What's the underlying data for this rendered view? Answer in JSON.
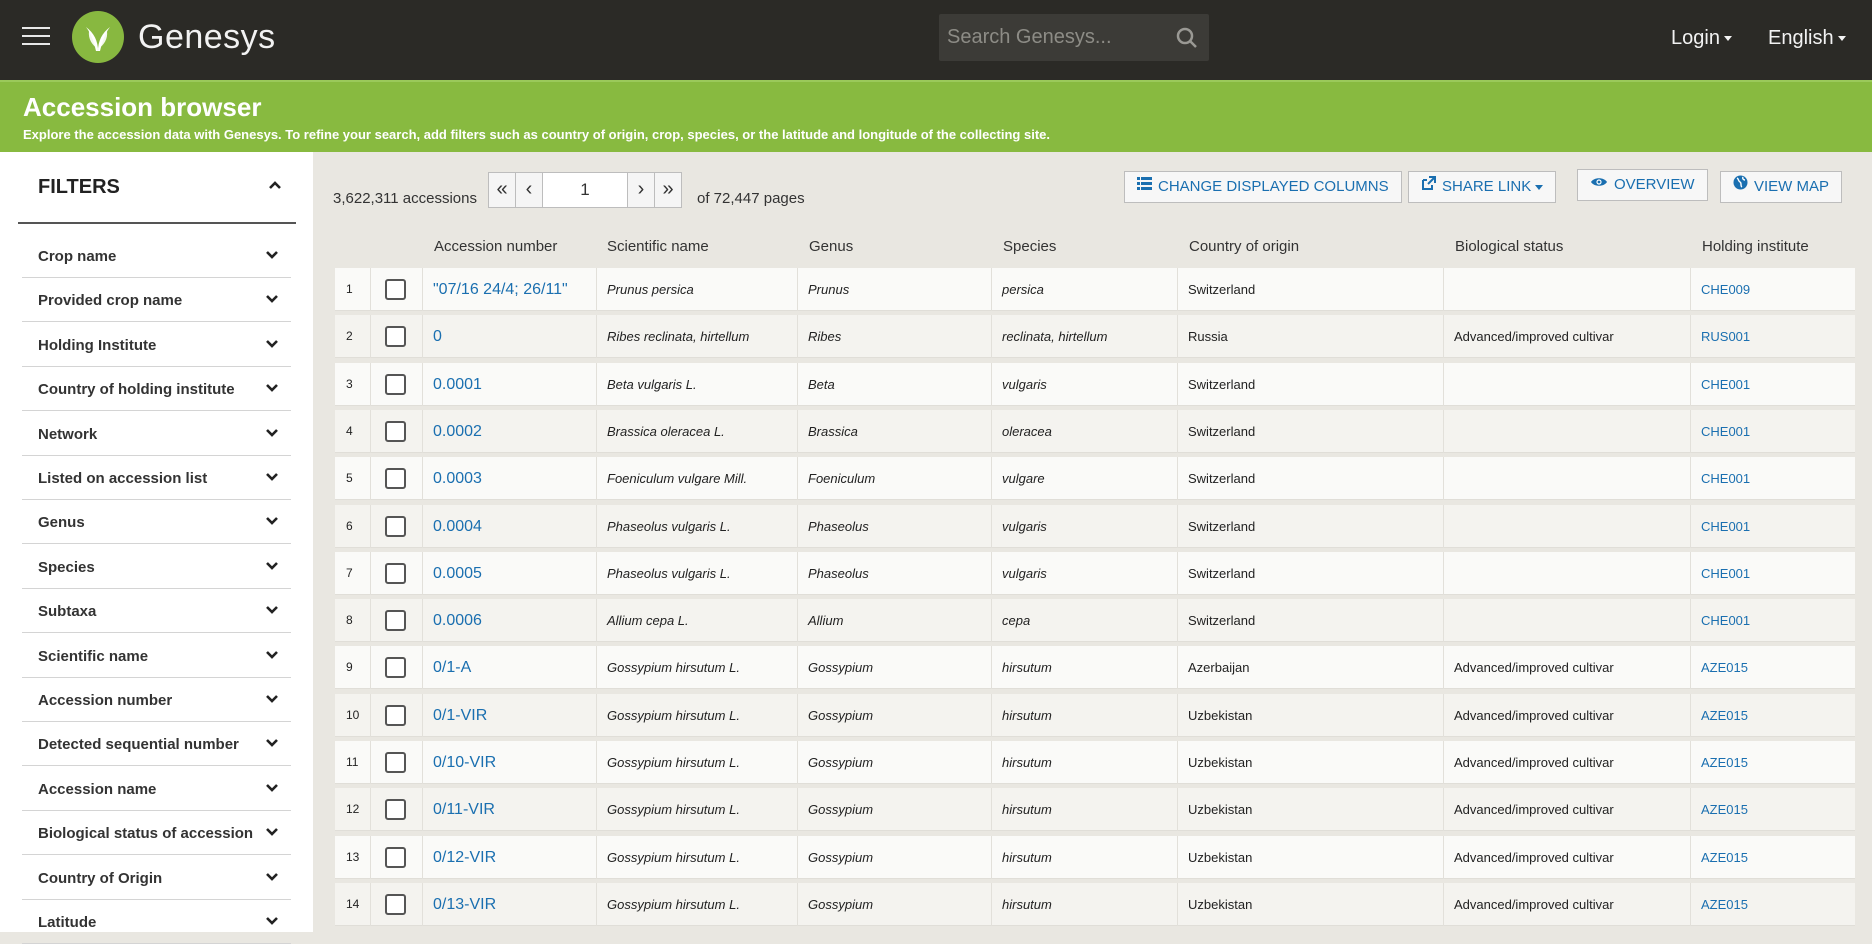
{
  "header": {
    "brand": "Genesys",
    "search_placeholder": "Search Genesys...",
    "login_label": "Login",
    "language_label": "English"
  },
  "banner": {
    "title": "Accession browser",
    "subtitle": "Explore the accession data with Genesys. To refine your search, add filters such as country of origin, crop, species, or the latitude and longitude of the collecting site."
  },
  "sidebar": {
    "title": "FILTERS",
    "items": [
      {
        "label": "Crop name"
      },
      {
        "label": "Provided crop name"
      },
      {
        "label": "Holding Institute"
      },
      {
        "label": "Country of holding institute"
      },
      {
        "label": "Network"
      },
      {
        "label": "Listed on accession list"
      },
      {
        "label": "Genus"
      },
      {
        "label": "Species"
      },
      {
        "label": "Subtaxa"
      },
      {
        "label": "Scientific name"
      },
      {
        "label": "Accession number"
      },
      {
        "label": "Detected sequential number"
      },
      {
        "label": "Accession name"
      },
      {
        "label": "Biological status of accession"
      },
      {
        "label": "Country of Origin"
      },
      {
        "label": "Latitude"
      }
    ]
  },
  "toolbar": {
    "count_label": "3,622,311 accessions",
    "first": "«",
    "prev": "‹",
    "next": "›",
    "last": "»",
    "page_value": "1",
    "pages_label": "of 72,447 pages",
    "change_columns": "CHANGE DISPLAYED COLUMNS",
    "share_link": "SHARE LINK",
    "overview": "OVERVIEW",
    "view_map": "VIEW MAP"
  },
  "table": {
    "columns": [
      "Accession number",
      "Scientific name",
      "Genus",
      "Species",
      "Country of origin",
      "Biological status",
      "Holding institute"
    ],
    "rows": [
      {
        "n": "1",
        "acc": "\"07/16 24/4; 26/11\"",
        "sci": "Prunus persica",
        "genus": "Prunus",
        "species": "persica",
        "country": "Switzerland",
        "status": "",
        "inst": "CHE009"
      },
      {
        "n": "2",
        "acc": "0",
        "sci": "Ribes reclinata, hirtellum",
        "genus": "Ribes",
        "species": "reclinata, hirtellum",
        "country": "Russia",
        "status": "Advanced/improved cultivar",
        "inst": "RUS001"
      },
      {
        "n": "3",
        "acc": "0.0001",
        "sci": "Beta vulgaris L.",
        "genus": "Beta",
        "species": "vulgaris",
        "country": "Switzerland",
        "status": "",
        "inst": "CHE001"
      },
      {
        "n": "4",
        "acc": "0.0002",
        "sci": "Brassica oleracea L.",
        "genus": "Brassica",
        "species": "oleracea",
        "country": "Switzerland",
        "status": "",
        "inst": "CHE001"
      },
      {
        "n": "5",
        "acc": "0.0003",
        "sci": "Foeniculum vulgare Mill.",
        "genus": "Foeniculum",
        "species": "vulgare",
        "country": "Switzerland",
        "status": "",
        "inst": "CHE001"
      },
      {
        "n": "6",
        "acc": "0.0004",
        "sci": "Phaseolus vulgaris L.",
        "genus": "Phaseolus",
        "species": "vulgaris",
        "country": "Switzerland",
        "status": "",
        "inst": "CHE001"
      },
      {
        "n": "7",
        "acc": "0.0005",
        "sci": "Phaseolus vulgaris L.",
        "genus": "Phaseolus",
        "species": "vulgaris",
        "country": "Switzerland",
        "status": "",
        "inst": "CHE001"
      },
      {
        "n": "8",
        "acc": "0.0006",
        "sci": "Allium cepa L.",
        "genus": "Allium",
        "species": "cepa",
        "country": "Switzerland",
        "status": "",
        "inst": "CHE001"
      },
      {
        "n": "9",
        "acc": "0/1-A",
        "sci": "Gossypium hirsutum L.",
        "genus": "Gossypium",
        "species": "hirsutum",
        "country": "Azerbaijan",
        "status": "Advanced/improved cultivar",
        "inst": "AZE015"
      },
      {
        "n": "10",
        "acc": "0/1-VIR",
        "sci": "Gossypium hirsutum L.",
        "genus": "Gossypium",
        "species": "hirsutum",
        "country": "Uzbekistan",
        "status": "Advanced/improved cultivar",
        "inst": "AZE015"
      },
      {
        "n": "11",
        "acc": "0/10-VIR",
        "sci": "Gossypium hirsutum L.",
        "genus": "Gossypium",
        "species": "hirsutum",
        "country": "Uzbekistan",
        "status": "Advanced/improved cultivar",
        "inst": "AZE015"
      },
      {
        "n": "12",
        "acc": "0/11-VIR",
        "sci": "Gossypium hirsutum L.",
        "genus": "Gossypium",
        "species": "hirsutum",
        "country": "Uzbekistan",
        "status": "Advanced/improved cultivar",
        "inst": "AZE015"
      },
      {
        "n": "13",
        "acc": "0/12-VIR",
        "sci": "Gossypium hirsutum L.",
        "genus": "Gossypium",
        "species": "hirsutum",
        "country": "Uzbekistan",
        "status": "Advanced/improved cultivar",
        "inst": "AZE015"
      },
      {
        "n": "14",
        "acc": "0/13-VIR",
        "sci": "Gossypium hirsutum L.",
        "genus": "Gossypium",
        "species": "hirsutum",
        "country": "Uzbekistan",
        "status": "Advanced/improved cultivar",
        "inst": "AZE015"
      }
    ]
  },
  "colors": {
    "topbar": "#2b2a26",
    "green": "#88ba40",
    "link": "#1a6fb0"
  }
}
